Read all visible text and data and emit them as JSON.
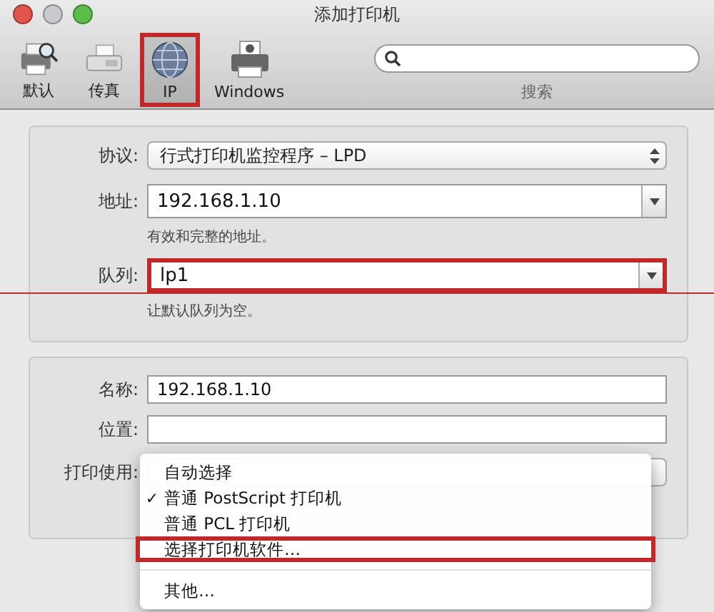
{
  "window": {
    "title": "添加打印机"
  },
  "toolbar": [
    {
      "label": "默认",
      "kind": "default",
      "selected": false,
      "highlighted": false
    },
    {
      "label": "传真",
      "kind": "fax",
      "selected": false,
      "highlighted": false
    },
    {
      "label": "IP",
      "kind": "ip",
      "selected": true,
      "highlighted": true
    },
    {
      "label": "Windows",
      "kind": "windows",
      "selected": false,
      "highlighted": false
    }
  ],
  "search": {
    "label": "搜索"
  },
  "connection": {
    "protocol": {
      "label": "协议:",
      "value": "行式打印机监控程序 – LPD"
    },
    "address": {
      "label": "地址:",
      "value": "192.168.1.10",
      "hint": "有效和完整的地址。"
    },
    "queue": {
      "label": "队列:",
      "value": "lp1",
      "hint": "让默认队列为空。",
      "highlighted": true
    }
  },
  "details": {
    "name": {
      "label": "名称:",
      "value": "192.168.1.10"
    },
    "location": {
      "label": "位置:"
    },
    "print_using": {
      "label": "打印使用:"
    }
  },
  "menu_check_glyph": "✓",
  "menu": [
    {
      "label": "自动选择",
      "checked": false,
      "highlighted": false
    },
    {
      "label": "普通 PostScript 打印机",
      "checked": true,
      "highlighted": false
    },
    {
      "label": "普通 PCL 打印机",
      "checked": false,
      "highlighted": false
    },
    {
      "label": "选择打印机软件…",
      "checked": false,
      "highlighted": true,
      "separator_after": true
    },
    {
      "label": "其他…",
      "checked": false,
      "highlighted": false
    }
  ]
}
